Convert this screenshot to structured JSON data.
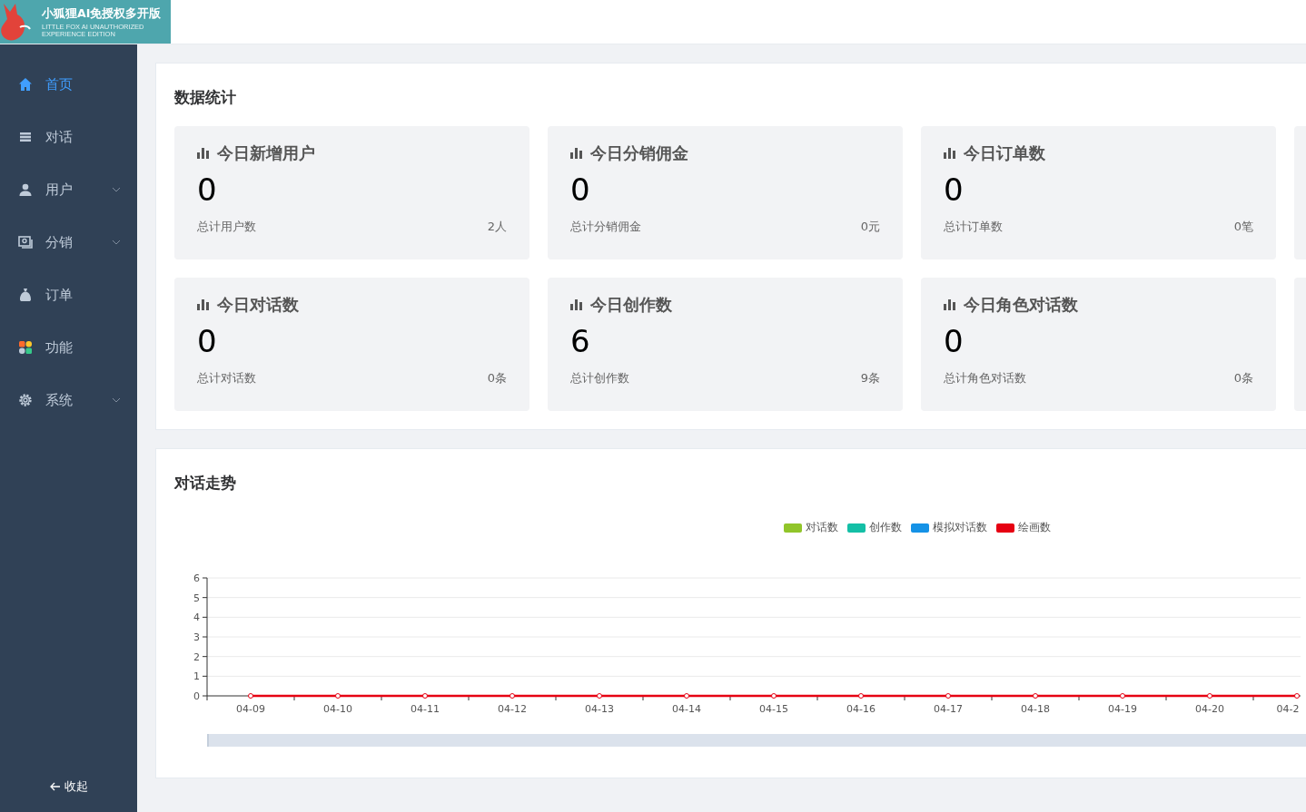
{
  "logo": {
    "title": "小狐狸AI免授权多开版",
    "subtitle": "LITTLE FOX AI UNAUTHORIZED EXPERIENCE EDITION"
  },
  "sidebar": {
    "items": [
      {
        "kind": "home",
        "label": "首页",
        "selected": true,
        "expandable": false
      },
      {
        "kind": "list",
        "label": "对话",
        "selected": false,
        "expandable": false
      },
      {
        "kind": "user",
        "label": "用户",
        "selected": false,
        "expandable": true
      },
      {
        "kind": "frame",
        "label": "分销",
        "selected": false,
        "expandable": true
      },
      {
        "kind": "bag",
        "label": "订单",
        "selected": false,
        "expandable": false
      },
      {
        "kind": "grid",
        "label": "功能",
        "selected": false,
        "expandable": false
      },
      {
        "kind": "gear",
        "label": "系统",
        "selected": false,
        "expandable": true
      }
    ],
    "collapse": "收起"
  },
  "stats_panel": {
    "title": "数据统计",
    "cards": [
      {
        "kind": "stat",
        "title": "今日新增用户",
        "value": "0",
        "footer_label": "总计用户数",
        "footer_value": "2人"
      },
      {
        "kind": "stat",
        "title": "今日分销佣金",
        "value": "0",
        "footer_label": "总计分销佣金",
        "footer_value": "0元"
      },
      {
        "kind": "stat",
        "title": "今日订单数",
        "value": "0",
        "footer_label": "总计订单数",
        "footer_value": "0笔"
      },
      {
        "kind": "clipped"
      },
      {
        "kind": "stat",
        "title": "今日对话数",
        "value": "0",
        "footer_label": "总计对话数",
        "footer_value": "0条"
      },
      {
        "kind": "stat",
        "title": "今日创作数",
        "value": "6",
        "footer_label": "总计创作数",
        "footer_value": "9条"
      },
      {
        "kind": "stat",
        "title": "今日角色对话数",
        "value": "0",
        "footer_label": "总计角色对话数",
        "footer_value": "0条"
      },
      {
        "kind": "clipped"
      }
    ]
  },
  "trend_panel": {
    "title": "对话走势",
    "chart_data": {
      "type": "line",
      "grid": true,
      "categories": [
        "04-09",
        "04-10",
        "04-11",
        "04-12",
        "04-13",
        "04-14",
        "04-15",
        "04-16",
        "04-17",
        "04-18",
        "04-19",
        "04-20",
        "04-2"
      ],
      "ylim": [
        0,
        6
      ],
      "yticks": [
        0,
        1,
        2,
        3,
        4,
        5,
        6
      ],
      "series": [
        {
          "name": "对话数",
          "color": "#91c52a",
          "marker": true,
          "values": [
            null,
            null,
            null,
            null,
            null,
            null,
            null,
            null,
            null,
            null,
            null,
            null,
            null
          ]
        },
        {
          "name": "创作数",
          "color": "#14bfa6",
          "marker": true,
          "values": [
            null,
            null,
            null,
            null,
            null,
            null,
            null,
            null,
            null,
            null,
            null,
            null,
            null
          ]
        },
        {
          "name": "模拟对话数",
          "color": "#1592e6",
          "marker": true,
          "values": [
            null,
            null,
            null,
            null,
            null,
            null,
            null,
            null,
            null,
            null,
            null,
            null,
            null
          ]
        },
        {
          "name": "绘画数",
          "color": "#e60012",
          "marker": true,
          "values": [
            0,
            0,
            0,
            0,
            0,
            0,
            0,
            0,
            0,
            0,
            0,
            0,
            0
          ]
        }
      ]
    }
  }
}
